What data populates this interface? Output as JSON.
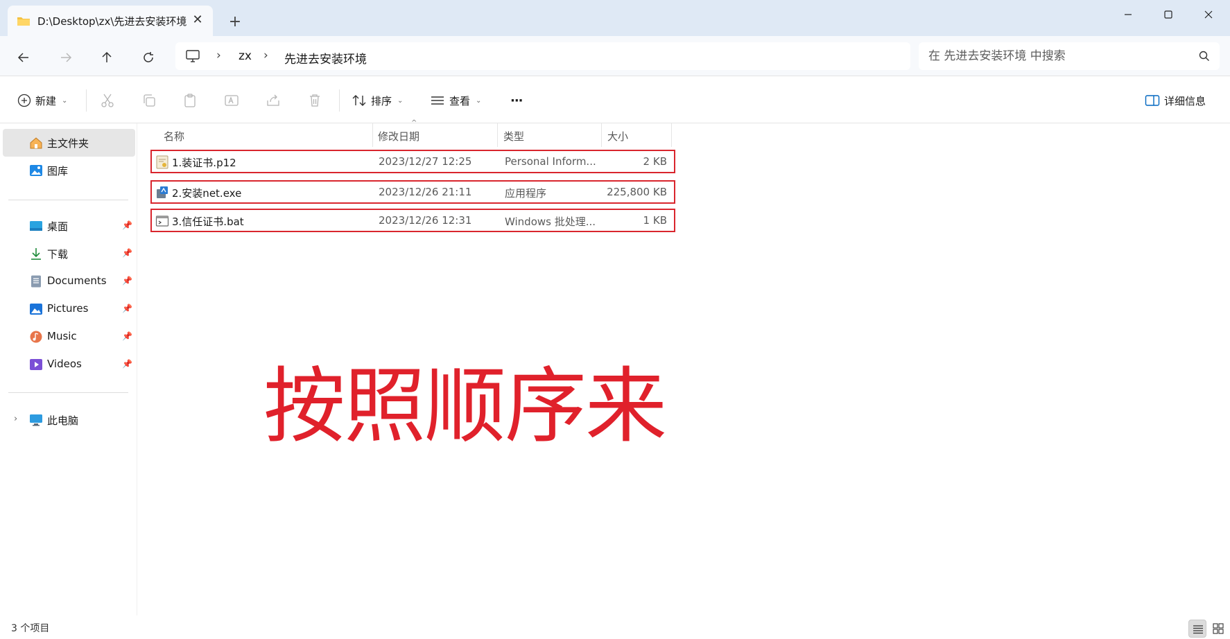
{
  "tab": {
    "title": "D:\\Desktop\\zx\\先进去安装环境",
    "close_symbol": "✕",
    "new_tab_symbol": "+"
  },
  "window_controls": [
    "minimize",
    "maximize",
    "close"
  ],
  "address": {
    "breadcrumbs": [
      "zx",
      "先进去安装环境"
    ],
    "separator": "›"
  },
  "search": {
    "placeholder": "在 先进去安装环境 中搜索"
  },
  "commands": {
    "new_label": "新建",
    "sort_label": "排序",
    "view_label": "查看",
    "more_label": "···",
    "details_label": "详细信息",
    "caret": "⌄"
  },
  "sidebar": {
    "quick": [
      {
        "label": "主文件夹",
        "icon": "home-icon",
        "selected": true
      },
      {
        "label": "图库",
        "icon": "gallery-icon",
        "selected": false
      }
    ],
    "pinned": [
      {
        "label": "桌面",
        "icon": "desktop-icon"
      },
      {
        "label": "下载",
        "icon": "download-icon"
      },
      {
        "label": "Documents",
        "icon": "documents-icon"
      },
      {
        "label": "Pictures",
        "icon": "pictures-icon"
      },
      {
        "label": "Music",
        "icon": "music-icon"
      },
      {
        "label": "Videos",
        "icon": "videos-icon"
      }
    ],
    "this_pc": {
      "label": "此电脑",
      "icon": "this-pc-icon",
      "expander": "›"
    }
  },
  "columns": {
    "name": "名称",
    "date": "修改日期",
    "type": "类型",
    "size": "大小"
  },
  "files": [
    {
      "name": "1.装证书.p12",
      "date": "2023/12/27 12:25",
      "type": "Personal Inform...",
      "size": "2 KB",
      "icon": "certificate-file-icon"
    },
    {
      "name": "2.安装net.exe",
      "date": "2023/12/26 21:11",
      "type": "应用程序",
      "size": "225,800 KB",
      "icon": "installer-exe-icon"
    },
    {
      "name": "3.信任证书.bat",
      "date": "2023/12/26 12:31",
      "type": "Windows 批处理...",
      "size": "1 KB",
      "icon": "batch-file-icon"
    }
  ],
  "annotation_text": "按照顺序来",
  "status": {
    "item_count": "3 个项目"
  },
  "colors": {
    "accent": "#0067c0",
    "annotation_red": "#e0212b",
    "titlebar_bg": "#dfe9f5"
  }
}
